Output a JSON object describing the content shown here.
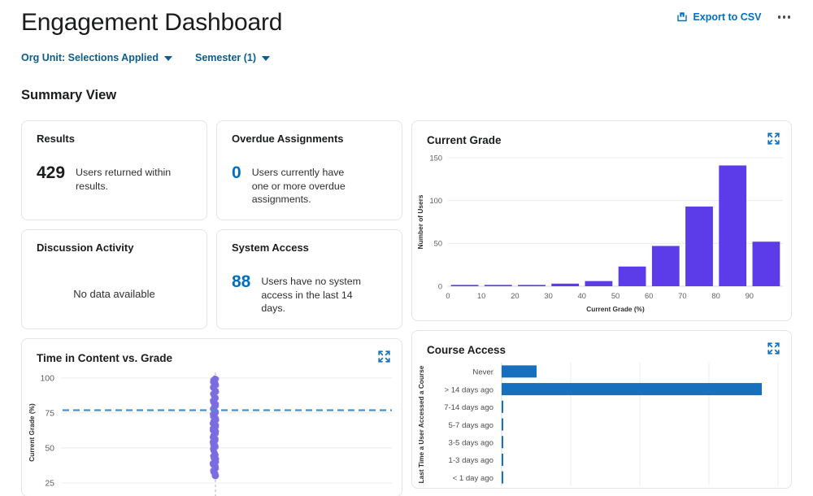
{
  "header": {
    "title": "Engagement Dashboard",
    "export_label": "Export to CSV",
    "export_icon": "export-icon",
    "more_icon": "more-options-icon"
  },
  "filters": [
    {
      "label": "Org Unit: Selections Applied",
      "icon": "chevron-down-icon"
    },
    {
      "label": "Semester (1)",
      "icon": "chevron-down-icon"
    }
  ],
  "summary": {
    "heading": "Summary View"
  },
  "cards": {
    "results": {
      "title": "Results",
      "value": "429",
      "description": "Users returned within results."
    },
    "overdue": {
      "title": "Overdue Assignments",
      "value": "0",
      "description": "Users currently have one or more overdue assignments."
    },
    "discussion": {
      "title": "Discussion Activity",
      "empty": "No data available"
    },
    "system_access": {
      "title": "System Access",
      "value": "88",
      "description": "Users have no system access in the last 14 days."
    }
  },
  "panels": {
    "current_grade": {
      "title": "Current Grade",
      "expand_icon": "expand-icon"
    },
    "time_vs_grade": {
      "title": "Time in Content vs. Grade",
      "expand_icon": "expand-icon"
    },
    "course_access": {
      "title": "Course Access",
      "expand_icon": "expand-icon"
    }
  },
  "colors": {
    "accent_blue": "#006fbf",
    "filter_blue": "#0c5c8e",
    "bar_purple": "#5b3ce8",
    "scatter_purple": "#7b6ce0",
    "bar_blue": "#1670bd",
    "dashed_blue": "#4a90c8",
    "card_border": "#e3e4e5"
  },
  "chart_data": [
    {
      "id": "current_grade",
      "type": "bar",
      "title": "Current Grade",
      "xlabel": "Current Grade (%)",
      "ylabel": "Number of Users",
      "xticks": [
        0,
        10,
        20,
        30,
        40,
        50,
        60,
        70,
        80,
        90
      ],
      "yticks": [
        0,
        50,
        100,
        150
      ],
      "xlim": [
        0,
        100
      ],
      "ylim": [
        0,
        150
      ],
      "grid": true,
      "bin_width": 10,
      "bin_starts": [
        0,
        10,
        20,
        30,
        40,
        50,
        60,
        70,
        80,
        90
      ],
      "categories": [
        "0-10",
        "10-20",
        "20-30",
        "30-40",
        "40-50",
        "50-60",
        "60-70",
        "70-80",
        "80-90",
        "90-100"
      ],
      "values": [
        1,
        1,
        1,
        3,
        6,
        23,
        47,
        93,
        141,
        52
      ],
      "color": "#5b3ce8"
    },
    {
      "id": "time_vs_grade",
      "type": "scatter",
      "title": "Time in Content vs. Grade",
      "ylabel": "Current Grade (%)",
      "xlabel": "",
      "yticks": [
        25,
        50,
        75,
        100
      ],
      "ylim": [
        18,
        104
      ],
      "grid": true,
      "reference_line": {
        "orientation": "horizontal",
        "value": 77,
        "style": "dashed",
        "color": "#4a90c8"
      },
      "vertical_line": {
        "value": 0,
        "style": "dashed",
        "color": "#9aa0a6"
      },
      "cluster_x": 0,
      "cluster_y_range": [
        30,
        100
      ],
      "point_count": 429,
      "color": "#7b6ce0"
    },
    {
      "id": "course_access",
      "type": "bar",
      "orientation": "horizontal",
      "title": "Course Access",
      "ylabel": "Last Time a User Accessed a Course",
      "xlabel": "",
      "categories": [
        "Never",
        "> 14 days ago",
        "7-14 days ago",
        "5-7 days ago",
        "3-5 days ago",
        "1-3 days ago",
        "< 1 day ago"
      ],
      "values": [
        43,
        320,
        1,
        1,
        1,
        1,
        1
      ],
      "xlim": [
        0,
        340
      ],
      "grid": true,
      "color": "#1670bd"
    }
  ]
}
